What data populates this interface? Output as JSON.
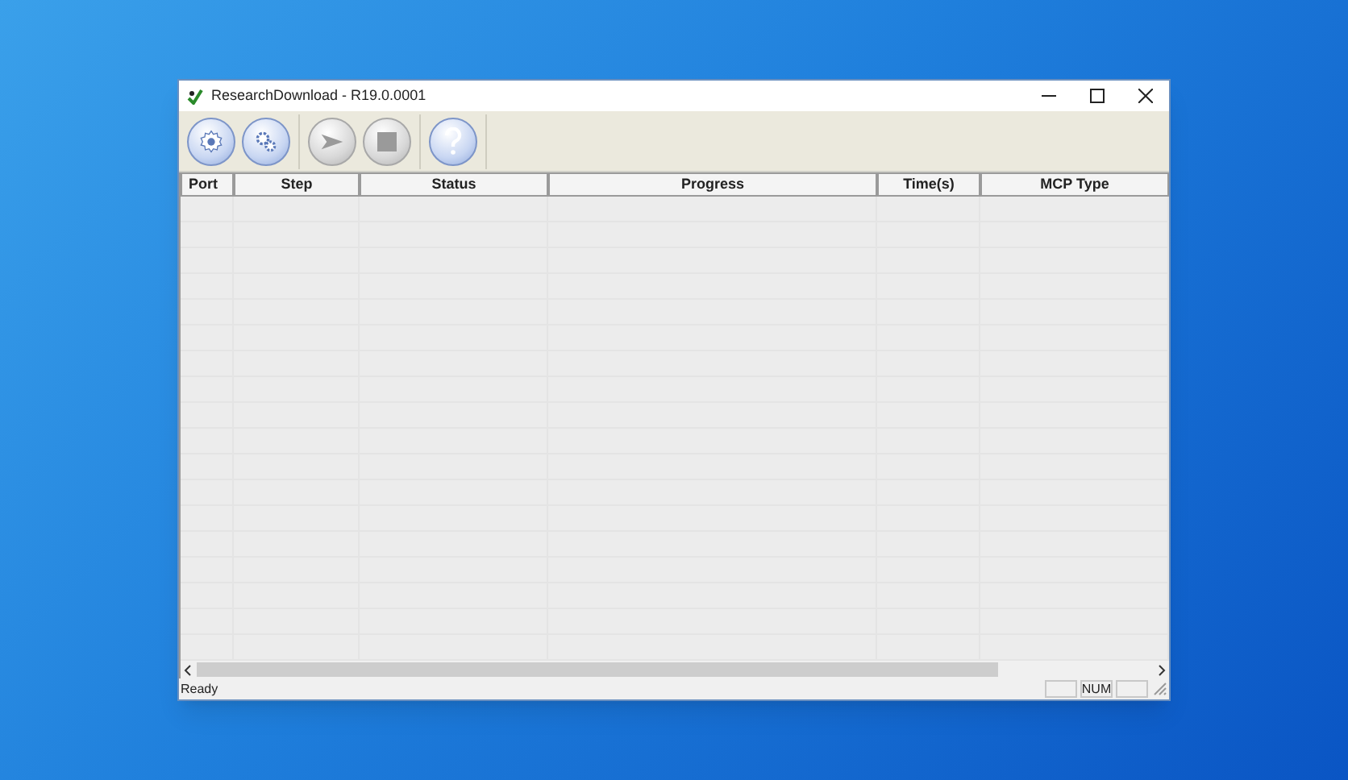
{
  "window": {
    "title": "ResearchDownload - R19.0.0001"
  },
  "toolbar": [
    {
      "kind": "gear",
      "disabled": false
    },
    {
      "kind": "gears",
      "disabled": false
    },
    {
      "kind": "play",
      "disabled": true
    },
    {
      "kind": "stop",
      "disabled": true
    },
    {
      "kind": "help",
      "disabled": false
    }
  ],
  "table": {
    "columns": [
      "Port",
      "Step",
      "Status",
      "Progress",
      "Time(s)",
      "MCP Type"
    ]
  },
  "status_bar": {
    "text": "Ready",
    "num_indicator": "NUM"
  }
}
